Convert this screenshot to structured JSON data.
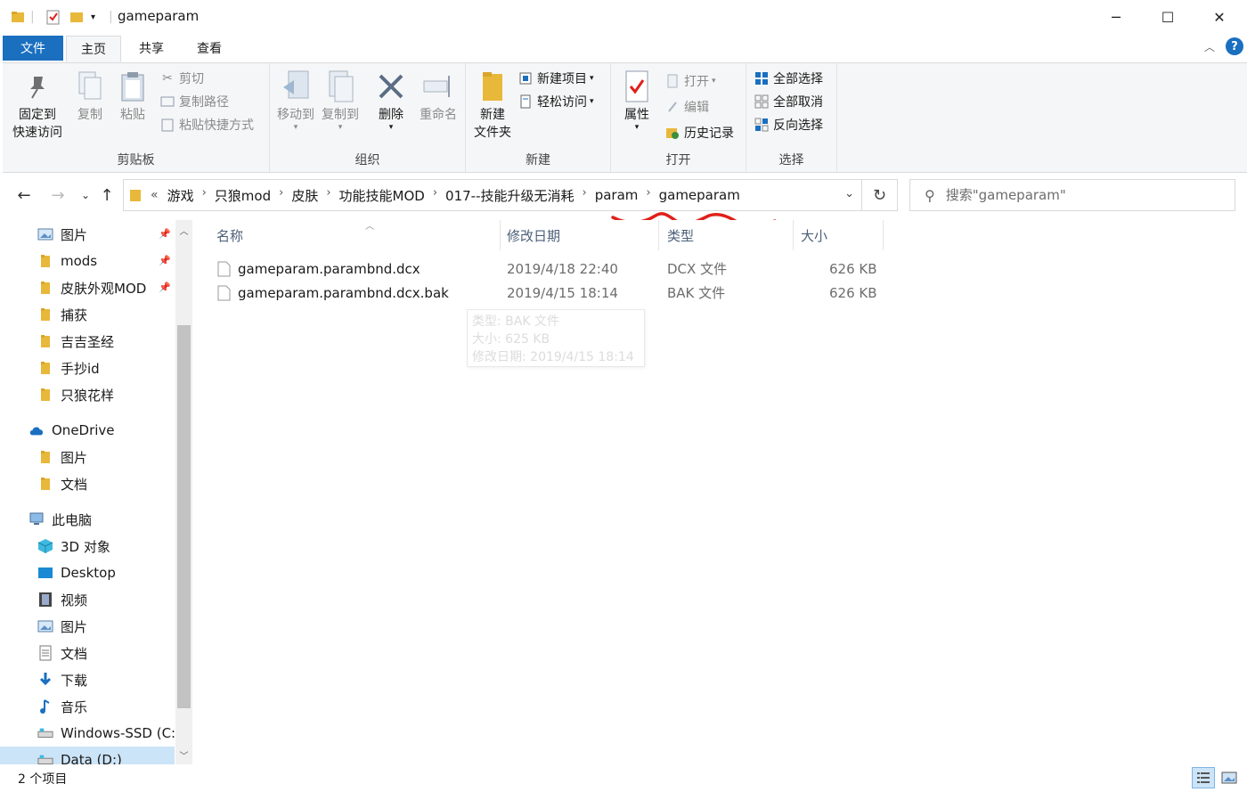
{
  "window": {
    "title": "gameparam",
    "controls": {
      "minimize": "─",
      "maximize": "☐",
      "close": "✕"
    }
  },
  "ribbon_tabs": {
    "file": "文件",
    "home": "主页",
    "share": "共享",
    "view": "查看"
  },
  "ribbon": {
    "clipboard": {
      "label": "剪贴板",
      "pin_line1": "固定到",
      "pin_line2": "快速访问",
      "copy": "复制",
      "paste": "粘贴",
      "cut": "剪切",
      "copy_path": "复制路径",
      "paste_shortcut": "粘贴快捷方式"
    },
    "organize": {
      "label": "组织",
      "move_to": "移动到",
      "copy_to": "复制到",
      "delete": "删除",
      "rename": "重命名"
    },
    "new": {
      "label": "新建",
      "new_folder_line1": "新建",
      "new_folder_line2": "文件夹",
      "new_item": "新建项目",
      "easy_access": "轻松访问"
    },
    "open": {
      "label": "打开",
      "properties": "属性",
      "open": "打开",
      "edit": "编辑",
      "history": "历史记录"
    },
    "select": {
      "label": "选择",
      "select_all": "全部选择",
      "select_none": "全部取消",
      "invert": "反向选择"
    }
  },
  "address": {
    "overflow": "«",
    "crumbs": [
      "游戏",
      "只狼mod",
      "皮肤",
      "功能技能MOD",
      "017--技能升级无消耗",
      "param",
      "gameparam"
    ]
  },
  "search": {
    "placeholder": "搜索\"gameparam\""
  },
  "nav_pane": {
    "items": [
      {
        "label": "图片",
        "icon": "picture-icon",
        "pinned": true
      },
      {
        "label": "mods",
        "icon": "folder-icon",
        "pinned": true
      },
      {
        "label": "皮肤外观MOD",
        "icon": "folder-icon",
        "pinned": true
      },
      {
        "label": "捕获",
        "icon": "folder-icon",
        "pinned": false
      },
      {
        "label": "吉吉圣经",
        "icon": "folder-icon",
        "pinned": false
      },
      {
        "label": "手抄id",
        "icon": "folder-icon",
        "pinned": false
      },
      {
        "label": "只狼花样",
        "icon": "folder-icon",
        "pinned": false
      },
      {
        "label": "OneDrive",
        "icon": "cloud-icon",
        "pinned": false
      },
      {
        "label": "图片",
        "icon": "folder-icon",
        "pinned": false
      },
      {
        "label": "文档",
        "icon": "folder-icon",
        "pinned": false
      },
      {
        "label": "此电脑",
        "icon": "computer-icon",
        "pinned": false
      },
      {
        "label": "3D 对象",
        "icon": "cube-icon",
        "pinned": false
      },
      {
        "label": "Desktop",
        "icon": "desktop-icon",
        "pinned": false
      },
      {
        "label": "视频",
        "icon": "film-icon",
        "pinned": false
      },
      {
        "label": "图片",
        "icon": "picture-icon",
        "pinned": false
      },
      {
        "label": "文档",
        "icon": "document-icon",
        "pinned": false
      },
      {
        "label": "下载",
        "icon": "download-icon",
        "pinned": false
      },
      {
        "label": "音乐",
        "icon": "music-icon",
        "pinned": false
      },
      {
        "label": "Windows-SSD (C:)",
        "icon": "drive-icon",
        "pinned": false
      },
      {
        "label": "Data (D:)",
        "icon": "drive-icon",
        "pinned": false
      }
    ]
  },
  "file_list": {
    "columns": {
      "name": "名称",
      "modified": "修改日期",
      "type": "类型",
      "size": "大小"
    },
    "rows": [
      {
        "name": "gameparam.parambnd.dcx",
        "modified": "2019/4/18 22:40",
        "type": "DCX 文件",
        "size": "626 KB"
      },
      {
        "name": "gameparam.parambnd.dcx.bak",
        "modified": "2019/4/15 18:14",
        "type": "BAK 文件",
        "size": "626 KB"
      }
    ]
  },
  "tooltip": {
    "type": "类型: BAK 文件",
    "size": "大小: 625 KB",
    "modified": "修改日期: 2019/4/15 18:14"
  },
  "status": {
    "count": "2 个项目"
  },
  "colors": {
    "accent": "#1a6fbf",
    "folder": "#e8b83a",
    "annotation": "#e0201b",
    "selected": "#cce4f7"
  }
}
